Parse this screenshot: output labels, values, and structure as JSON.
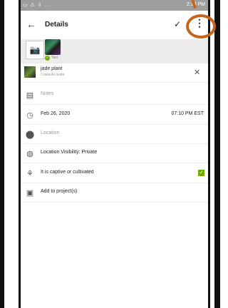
{
  "status_bar": {
    "left_icons": "▭ ⚠ ⇩ ...",
    "time": "2:13 PM"
  },
  "app_bar": {
    "title": "Details",
    "back_icon": "arrow-back",
    "confirm_icon": "check",
    "menu_icon": "more-vert"
  },
  "photos": {
    "status_label": "Taxi"
  },
  "taxon": {
    "common_name": "jade plant",
    "scientific_name": "Crassula ovata"
  },
  "fields": {
    "notes_placeholder": "Notes",
    "date": "Feb 26, 2020",
    "time": "07:10 PM EST",
    "location_placeholder": "Location",
    "visibility": "Location Visibility: Private",
    "captive_label": "It is captive or cultivated",
    "captive_checked": true,
    "project_label": "Add to project(s)"
  },
  "annotation": {
    "highlight_color": "#c5651b"
  }
}
